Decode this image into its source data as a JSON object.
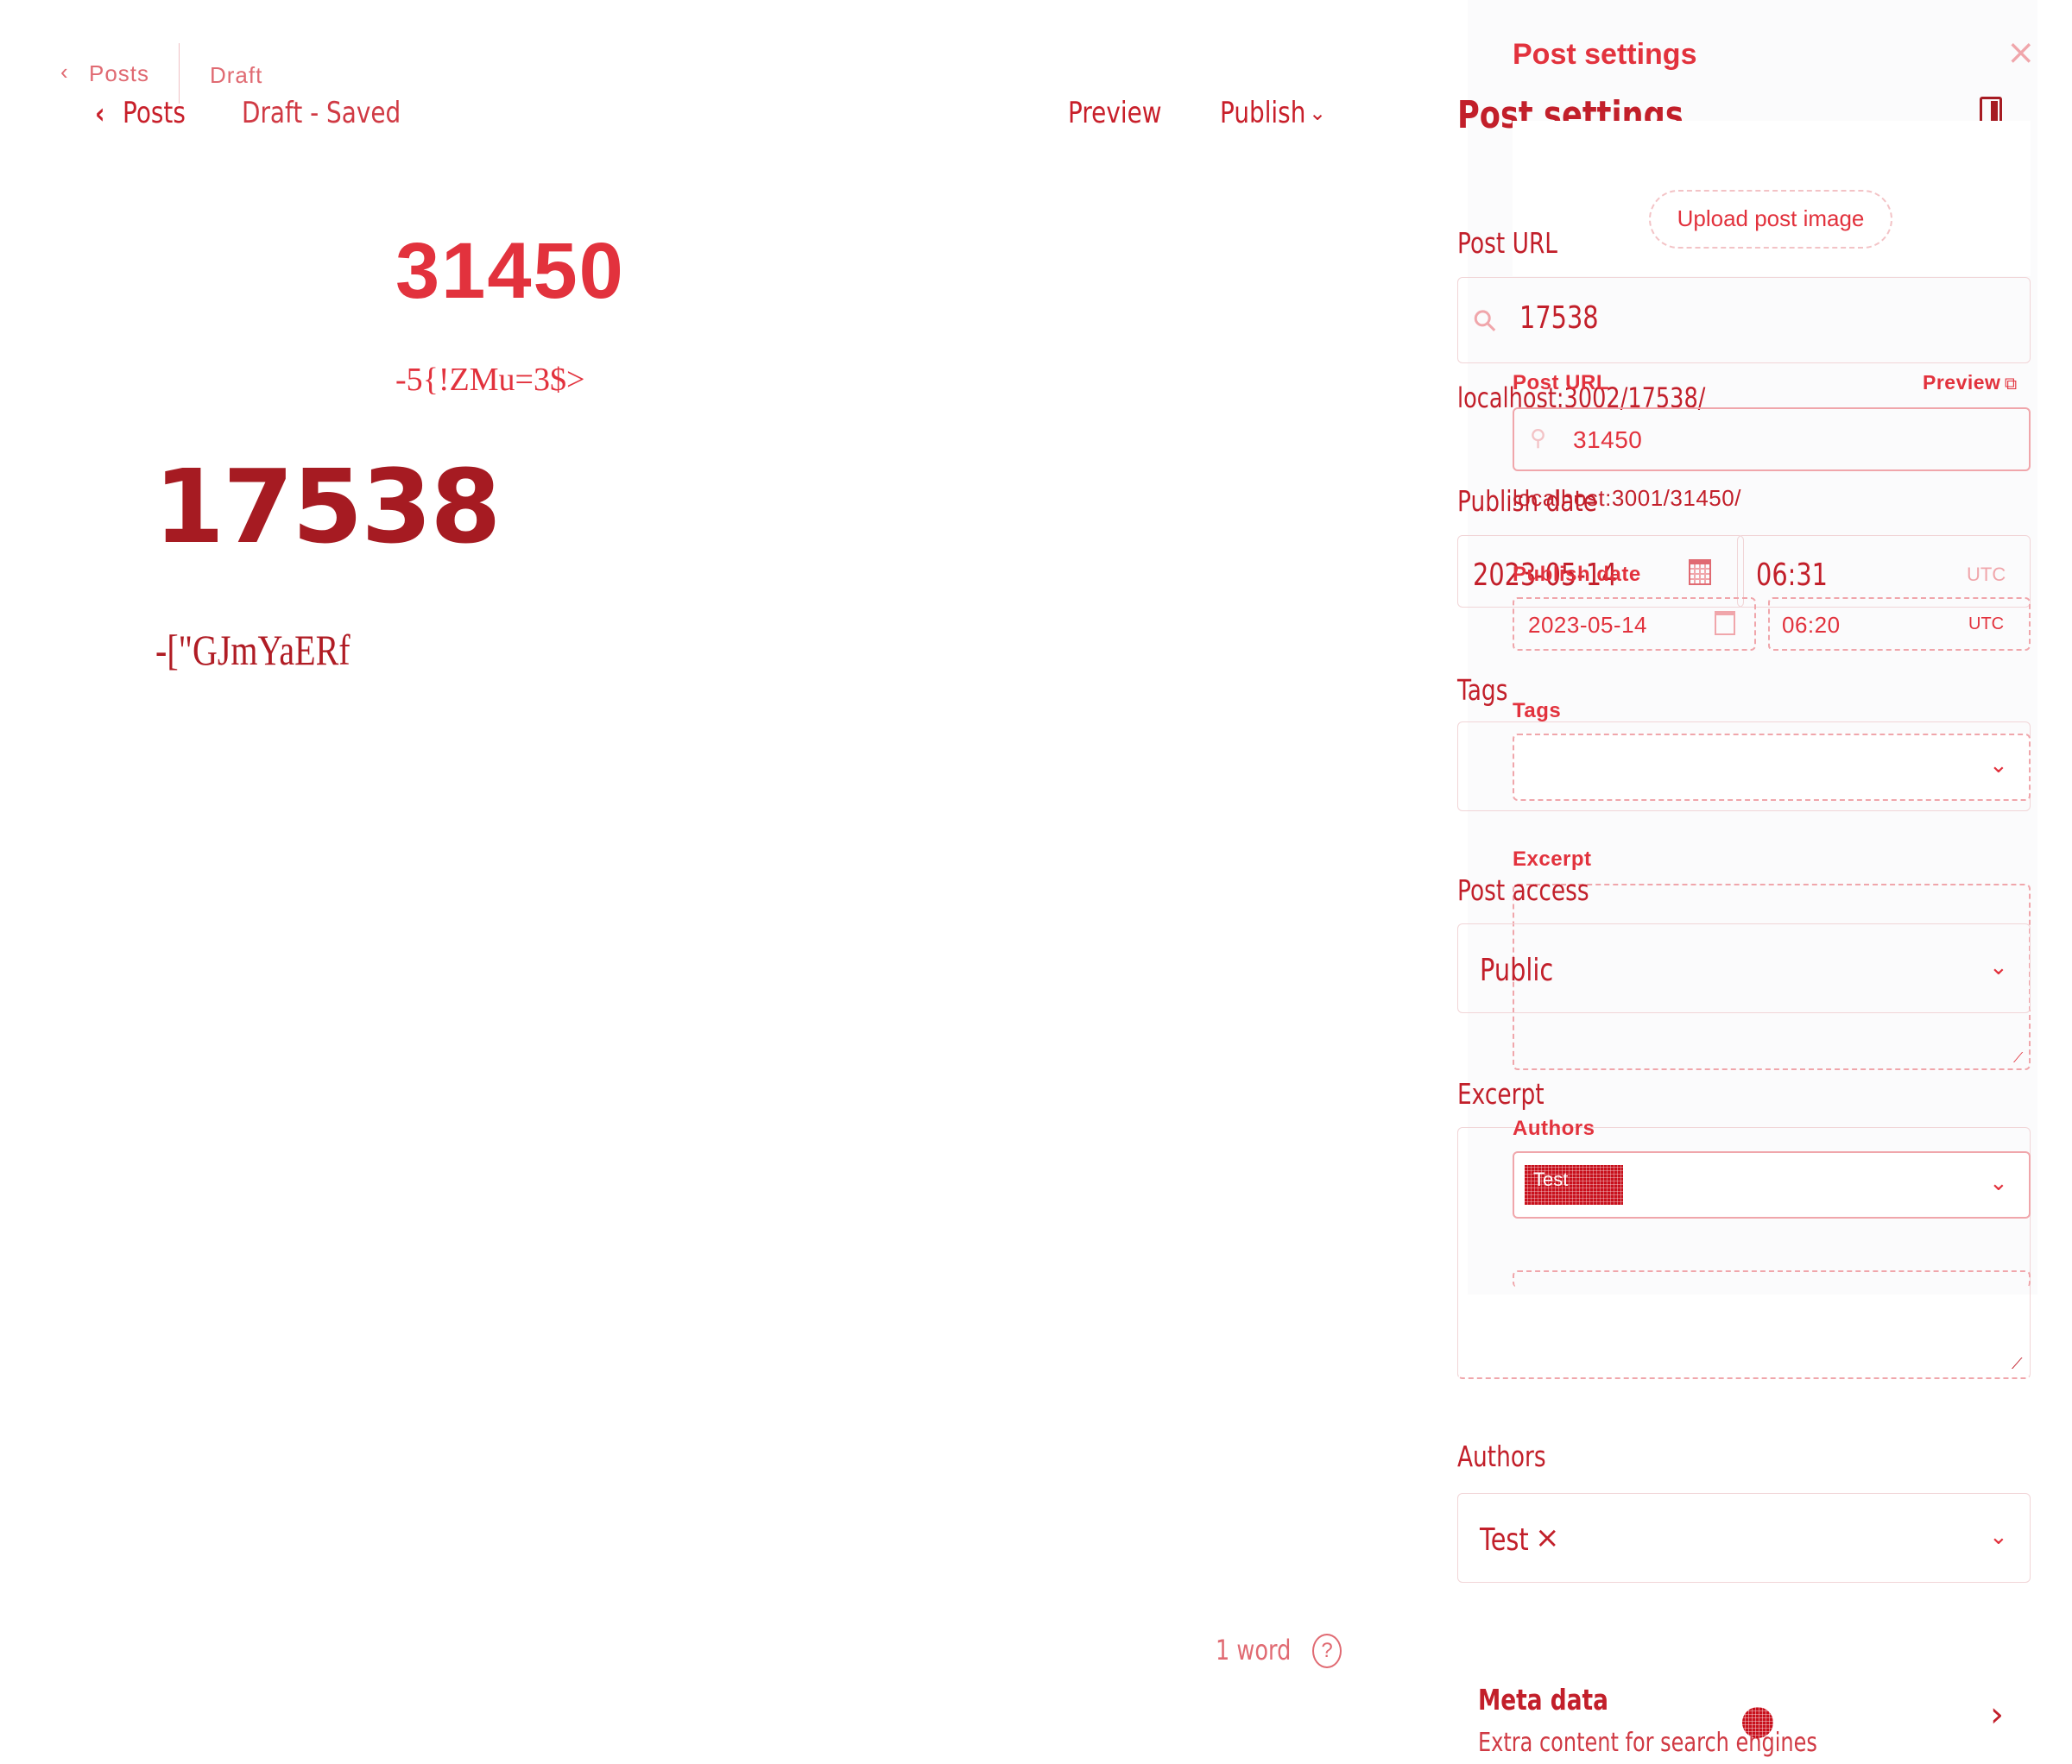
{
  "topbar": {
    "back_small": "Posts",
    "status_small": "Draft",
    "back_big": "Posts",
    "status_big": "Draft - Saved",
    "preview": "Preview",
    "publish": "Publish"
  },
  "editor": {
    "ghost_title": "31450",
    "ghost_subtitle": "-5{!ZMu=3$>",
    "title": "17538",
    "subtitle": "-[\"GJmYaERf",
    "word_count": "1 word",
    "help_glyph": "?"
  },
  "settings_small": {
    "heading": "Post settings",
    "upload_image": "Upload post image",
    "post_url_label": "Post URL",
    "preview_link": "Preview",
    "post_url_value": "31450",
    "post_url_hint": "localhost:3001/31450/",
    "publish_date_label": "Publish date",
    "date_value": "2023-05-14",
    "time_value": "06:20",
    "tz": "UTC",
    "tags_label": "Tags",
    "excerpt_label": "Excerpt",
    "authors_label": "Authors",
    "author_chip": "Test"
  },
  "settings_big": {
    "heading": "Post settings",
    "post_url_label": "Post URL",
    "post_url_value": "17538",
    "post_url_hint": "localhost:3002/17538/",
    "publish_date_label": "Publish date",
    "date_value": "2023-05-14",
    "time_value": "06:31",
    "tz": "UTC",
    "tags_label": "Tags",
    "post_access_label": "Post access",
    "post_access_value": "Public",
    "excerpt_label": "Excerpt",
    "authors_label": "Authors",
    "author_chip": "Test",
    "author_remove": "×",
    "meta_title": "Meta data",
    "meta_desc": "Extra content for search engines"
  },
  "colors": {
    "accent": "#d4242f",
    "dark_accent": "#b01c24",
    "pale_accent": "#f0a6ab"
  }
}
